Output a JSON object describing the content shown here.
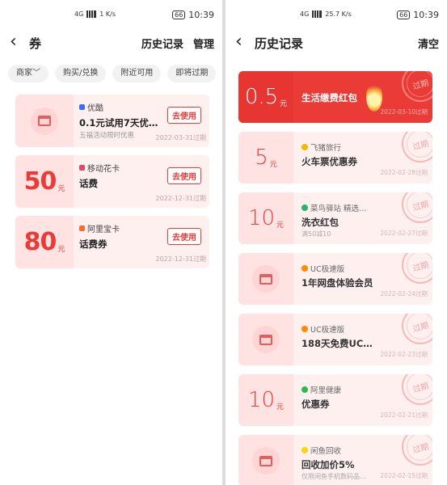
{
  "left": {
    "status": {
      "sig_a": "4G",
      "speed": "1 K/s",
      "time": "10:39",
      "battery": "66"
    },
    "nav": {
      "back_glyph": "‹",
      "title": "券",
      "history": "历史记录",
      "manage": "管理"
    },
    "filters": [
      "商家﹀",
      "购买/兑换",
      "附近可用",
      "即将过期"
    ],
    "coupons": [
      {
        "merchant": "优酷",
        "name": "0.1元试用7天优…",
        "desc": "五福活动限时优惠",
        "date": "2022-03-31过期",
        "btn": "去使用",
        "merchant_color": "#3b6bff"
      },
      {
        "merchant": "移动花卡",
        "name": "话费",
        "amount": "50",
        "unit": "元",
        "date": "2022-12-31过期",
        "btn": "去使用",
        "merchant_color": "#e0476b"
      },
      {
        "merchant": "阿里宝卡",
        "name": "话费券",
        "amount": "80",
        "unit": "元",
        "date": "2022-12-31过期",
        "btn": "去使用",
        "merchant_color": "#ff6a2a"
      }
    ]
  },
  "right": {
    "status": {
      "sig_a": "4G",
      "speed": "25.7 K/s",
      "time": "10:39",
      "battery": "66"
    },
    "nav": {
      "back_glyph": "‹",
      "title": "历史记录",
      "clear": "清空"
    },
    "coupons": [
      {
        "amount": "0.5",
        "unit": "元",
        "name": "生活缴费红包",
        "date": "2022-03-10过期",
        "stamp": "过期",
        "hot": true
      },
      {
        "amount": "5",
        "unit": "元",
        "merchant": "飞猪旅行",
        "name": "火车票优惠券",
        "date": "2022-02-28过期",
        "stamp": "过期",
        "merchant_color": "#f5b800"
      },
      {
        "amount": "10",
        "unit": "元",
        "merchant": "菜鸟驿站 精选…",
        "name": "洗衣红包",
        "desc": "满50减10",
        "date": "2022-02-27过期",
        "stamp": "过期",
        "merchant_color": "#27b36b"
      },
      {
        "merchant": "UC极速版",
        "name": "1年网盘体验会员",
        "date": "2022-02-24过期",
        "stamp": "过期",
        "merchant_color": "#ff8a00"
      },
      {
        "merchant": "UC极速版",
        "name": "188天免费UC…",
        "date": "2022-02-23过期",
        "stamp": "过期",
        "merchant_color": "#ff8a00"
      },
      {
        "amount": "10",
        "unit": "元",
        "merchant": "阿里健康",
        "name": "优惠券",
        "date": "2022-02-21过期",
        "stamp": "过期",
        "merchant_color": "#2fb84f"
      },
      {
        "merchant": "闲鱼回收",
        "name": "回收加价5%",
        "desc": "仅限闲鱼手机数码品…",
        "date": "2022-02-15过期",
        "stamp": "过期",
        "merchant_color": "#ffd400"
      }
    ]
  }
}
